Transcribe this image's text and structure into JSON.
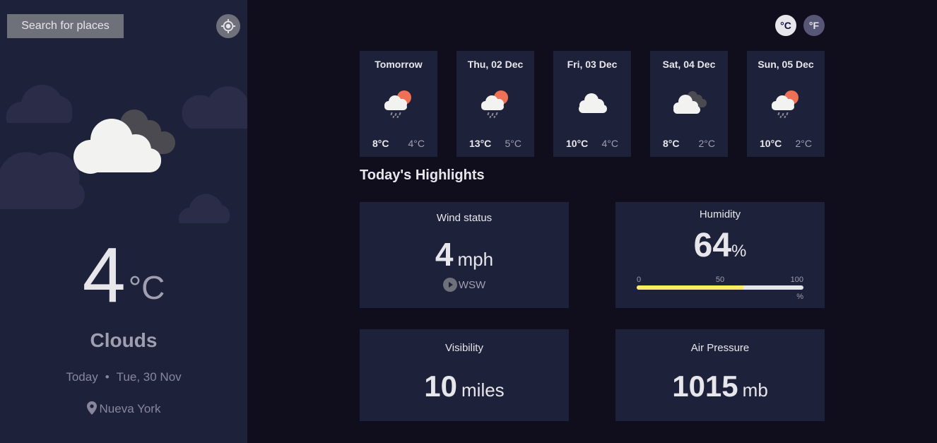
{
  "sidebar": {
    "search_label": "Search for places",
    "current": {
      "icon": "heavy-cloud-icon",
      "temp": "4",
      "unit": "°C",
      "condition": "Clouds",
      "date_prefix": "Today",
      "separator": "•",
      "date": "Tue, 30 Nov",
      "location": "Nueva York"
    }
  },
  "units": {
    "celsius": "°C",
    "fahrenheit": "°F",
    "selected": "celsius"
  },
  "forecast": [
    {
      "day": "Tomorrow",
      "icon": "light-rain-icon",
      "max": "8°C",
      "min": "4°C"
    },
    {
      "day": "Thu, 02 Dec",
      "icon": "light-rain-icon",
      "max": "13°C",
      "min": "5°C"
    },
    {
      "day": "Fri, 03 Dec",
      "icon": "light-cloud-icon",
      "max": "10°C",
      "min": "4°C"
    },
    {
      "day": "Sat, 04 Dec",
      "icon": "heavy-cloud-icon",
      "max": "8°C",
      "min": "2°C"
    },
    {
      "day": "Sun, 05 Dec",
      "icon": "light-rain-icon",
      "max": "10°C",
      "min": "2°C"
    }
  ],
  "highlights": {
    "title": "Today's Highlights",
    "wind": {
      "label": "Wind status",
      "value": "4",
      "unit": "mph",
      "direction": "WSW"
    },
    "humidity": {
      "label": "Humidity",
      "value": "64",
      "unit": "%",
      "scale_0": "0",
      "scale_50": "50",
      "scale_100": "100",
      "scale_unit": "%",
      "level": 0.64
    },
    "visibility": {
      "label": "Visibility",
      "value": "10",
      "unit": "miles"
    },
    "pressure": {
      "label": "Air Pressure",
      "value": "1015",
      "unit": "mb"
    }
  },
  "colors": {
    "bg": "#100e1d",
    "panel": "#1e213a",
    "accent_bar": "#ffec65",
    "muted": "#a09fb1",
    "sun": "#ef7155"
  }
}
